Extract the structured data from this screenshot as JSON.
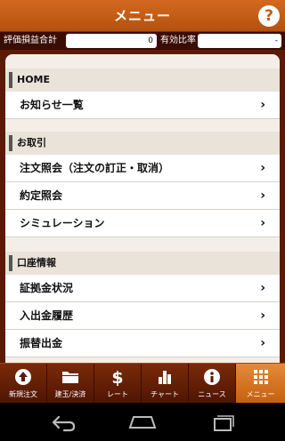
{
  "header": {
    "title": "メニュー",
    "help_glyph": "?"
  },
  "pl_bar": {
    "unrealized_label": "評価損益合計",
    "unrealized_value": "0",
    "ratio_label": "有効比率",
    "ratio_value": "-"
  },
  "sections": [
    {
      "heading": "HOME",
      "items": [
        "お知らせ一覧"
      ]
    },
    {
      "heading": "お取引",
      "items": [
        "注文照会（注文の訂正・取消）",
        "約定照会",
        "シミュレーション"
      ]
    },
    {
      "heading": "口座情報",
      "items": [
        "証拠金状況",
        "入出金履歴",
        "振替出金"
      ]
    }
  ],
  "chevron": "›",
  "tabs": [
    {
      "label": "新規注文",
      "icon": "up-arrow-circle-icon"
    },
    {
      "label": "建玉/決済",
      "icon": "folder-icon"
    },
    {
      "label": "レート",
      "icon": "dollar-icon"
    },
    {
      "label": "チャート",
      "icon": "bar-chart-icon"
    },
    {
      "label": "ニュース",
      "icon": "info-icon"
    },
    {
      "label": "メニュー",
      "icon": "grid-menu-icon",
      "active": true
    }
  ],
  "colors": {
    "accent": "#c55a11",
    "dark": "#3a0d04",
    "active_tab": "#d97a25"
  }
}
